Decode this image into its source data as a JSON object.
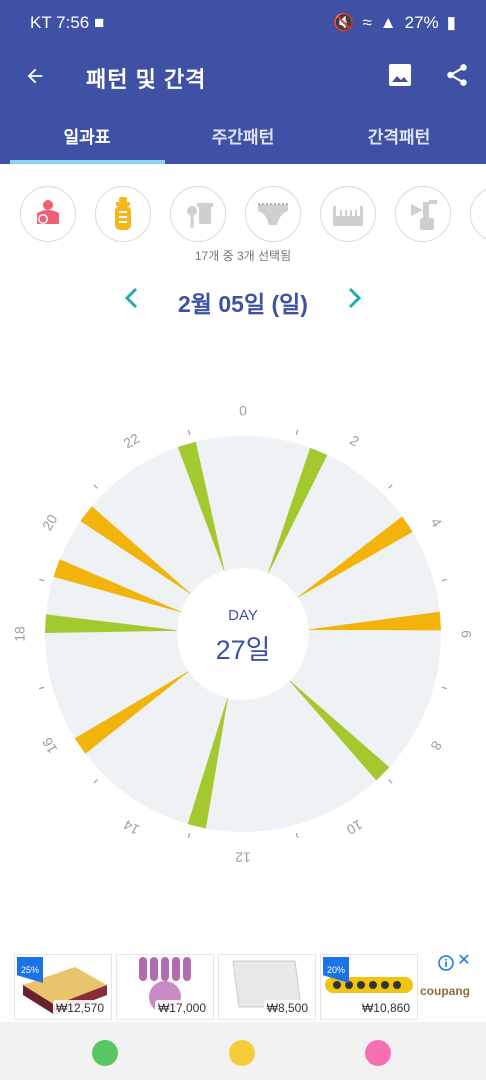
{
  "status": {
    "carrier": "KT",
    "time": "7:56",
    "battery": "27%"
  },
  "appbar": {
    "title": "패턴 및 간격"
  },
  "tabs": [
    {
      "label": "일과표",
      "active": true
    },
    {
      "label": "주간패턴",
      "active": false
    },
    {
      "label": "간격패턴",
      "active": false
    }
  ],
  "categories": [
    {
      "icon": "nursing-icon",
      "selected": true,
      "color": "#f06074"
    },
    {
      "icon": "bottle-icon",
      "selected": true,
      "color": "#f5b71a"
    },
    {
      "icon": "food-icon",
      "selected": false,
      "color": "#cfcfcf"
    },
    {
      "icon": "diaper-icon",
      "selected": false,
      "color": "#cfcfcf"
    },
    {
      "icon": "bed-icon",
      "selected": false,
      "color": "#cfcfcf"
    },
    {
      "icon": "pump-icon",
      "selected": false,
      "color": "#cfcfcf"
    },
    {
      "icon": "partial-icon",
      "selected": false,
      "color": "#f5d95a"
    }
  ],
  "selection_text": "17개 중 3개 선택됨",
  "date": {
    "label": "2월 05일 (일)"
  },
  "clock": {
    "center_top": "DAY",
    "center_value": "27일",
    "hour_labels": [
      "0",
      "2",
      "4",
      "6",
      "8",
      "10",
      "12",
      "14",
      "16",
      "18",
      "20",
      "22"
    ],
    "colors": {
      "green": "#a3c92f",
      "orange": "#f2b30b",
      "face": "#eef2f5"
    },
    "events": [
      {
        "hour": 1.5,
        "color": "green"
      },
      {
        "hour": 3.75,
        "color": "orange"
      },
      {
        "hour": 5.75,
        "color": "orange"
      },
      {
        "hour": 9.0,
        "color": "green"
      },
      {
        "hour": 12.9,
        "color": "green"
      },
      {
        "hour": 15.7,
        "color": "orange"
      },
      {
        "hour": 18.2,
        "color": "green"
      },
      {
        "hour": 19.3,
        "color": "orange"
      },
      {
        "hour": 20.5,
        "color": "orange"
      },
      {
        "hour": 22.9,
        "color": "green"
      }
    ]
  },
  "ads": {
    "items": [
      {
        "price": "₩12,570",
        "badge": "25%"
      },
      {
        "price": "₩17,000",
        "badge": ""
      },
      {
        "price": "₩8,500",
        "badge": ""
      },
      {
        "price": "₩10,860",
        "badge": "20%"
      }
    ],
    "brand": "coupang"
  },
  "bottom_dots": [
    {
      "color": "#58c760"
    },
    {
      "color": "#f7cc3a"
    },
    {
      "color": "#f76fb1"
    }
  ]
}
